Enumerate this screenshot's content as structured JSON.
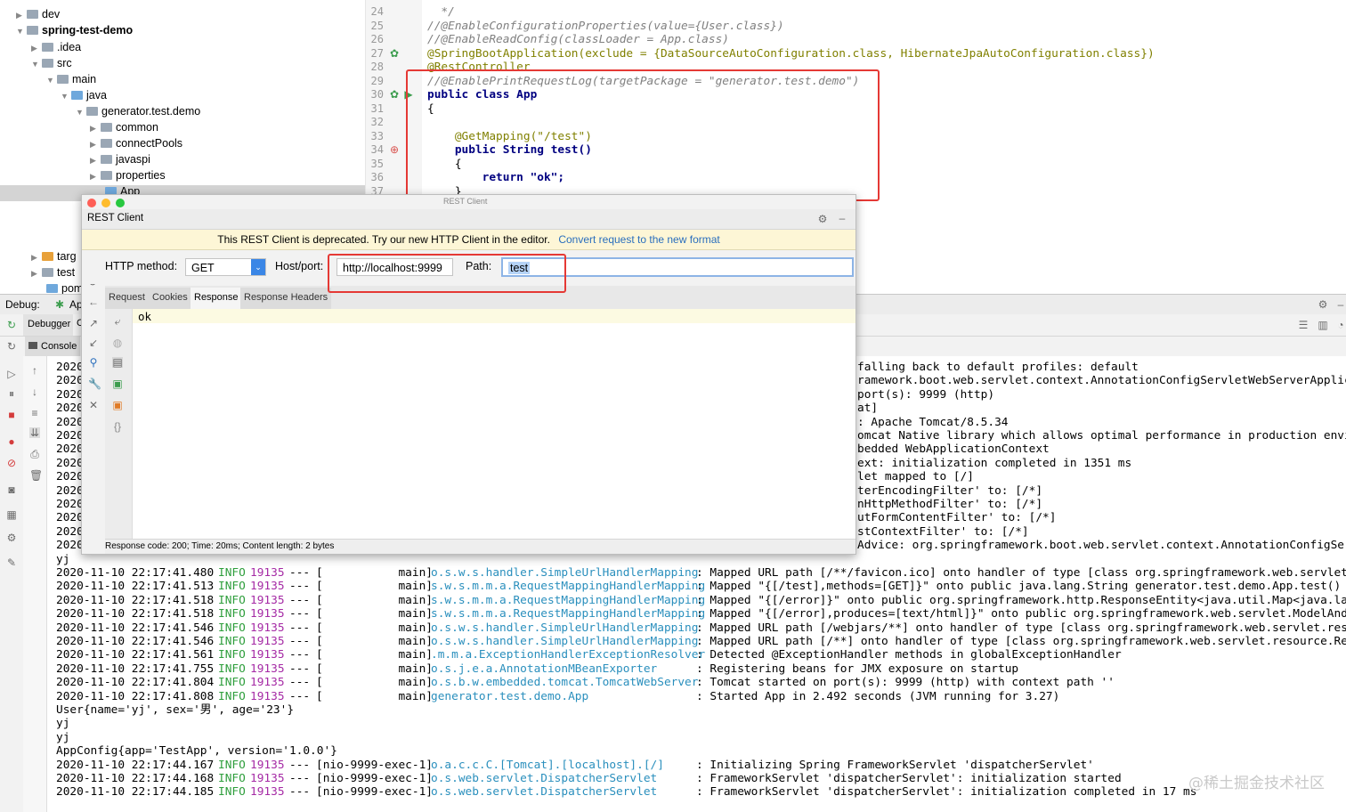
{
  "project_tree": {
    "items": [
      {
        "label": "dev"
      },
      {
        "label": "spring-test-demo"
      },
      {
        "label": ".idea"
      },
      {
        "label": "src"
      },
      {
        "label": "main"
      },
      {
        "label": "java"
      },
      {
        "label": "generator.test.demo"
      },
      {
        "label": "common"
      },
      {
        "label": "connectPools"
      },
      {
        "label": "javaspi"
      },
      {
        "label": "properties"
      },
      {
        "label": "App"
      },
      {
        "label": "targ"
      },
      {
        "label": "test"
      },
      {
        "label": "pom"
      }
    ]
  },
  "editor": {
    "line_numbers": [
      "24",
      "25",
      "26",
      "27",
      "28",
      "29",
      "30",
      "31",
      "32",
      "33",
      "34",
      "35",
      "36",
      "37"
    ],
    "lines": [
      {
        "text": "*/",
        "style": "cmt",
        "indent": "  "
      },
      {
        "text": "//@EnableConfigurationProperties(value={User.class})",
        "style": "cmt",
        "indent": ""
      },
      {
        "text": "//@EnableReadConfig(classLoader = App.class)",
        "style": "cmt",
        "indent": ""
      },
      {
        "text": "@SpringBootApplication(exclude = {DataSourceAutoConfiguration.class, HibernateJpaAutoConfiguration.class})",
        "style": "ann",
        "indent": ""
      },
      {
        "text": "@RestController",
        "style": "ann",
        "indent": ""
      },
      {
        "text": "//@EnablePrintRequestLog(targetPackage = \"generator.test.demo\")",
        "style": "cmt",
        "indent": ""
      },
      {
        "text": "public class App",
        "style": "kw",
        "indent": ""
      },
      {
        "text": "{",
        "style": "plain",
        "indent": ""
      },
      {
        "text": "",
        "style": "plain",
        "indent": ""
      },
      {
        "text": "@GetMapping(\"/test\")",
        "style": "ann",
        "indent": "    "
      },
      {
        "text": "public String test()",
        "style": "kw",
        "indent": "    "
      },
      {
        "text": "{",
        "style": "plain",
        "indent": "    "
      },
      {
        "text": "return \"ok\";",
        "style": "kw",
        "indent": "        "
      },
      {
        "text": "}",
        "style": "plain",
        "indent": "    "
      }
    ]
  },
  "rest_client": {
    "title": "REST Client",
    "overlay_label": "REST Client",
    "banner_text": "This REST Client is deprecated. Try our new HTTP Client in the editor.",
    "banner_link": "Convert request to the new format",
    "http_method_label": "HTTP method:",
    "http_method_value": "GET",
    "host_label": "Host/port:",
    "host_value": "http://localhost:9999",
    "path_label": "Path:",
    "path_value": "test",
    "tabs": [
      "Request",
      "Cookies",
      "Response",
      "Response Headers"
    ],
    "active_tab": "Response",
    "response_body": "ok",
    "status_line": "Response code: 200; Time: 20ms; Content length: 2 bytes"
  },
  "debug": {
    "label": "Debug:",
    "run_tab": "Ap",
    "tabs": [
      "Debugger",
      "C"
    ],
    "console_tab": "Console"
  },
  "console": {
    "partial_lines": [
      "2020",
      "2020",
      "2020",
      "2020",
      "2020",
      "2020",
      "2020",
      "2020",
      "2020",
      "2020",
      "2020",
      "2020",
      "2020",
      "2020"
    ],
    "right_fragments": [
      "falling back to default profiles: default",
      "ramework.boot.web.servlet.context.AnnotationConfigServletWebServerApplicatio",
      "port(s): 9999 (http)",
      "at]",
      ": Apache Tomcat/8.5.34",
      "omcat Native library which allows optimal performance in production environme",
      "bedded WebApplicationContext",
      "ext: initialization completed in 1351 ms",
      "let mapped to [/]",
      "terEncodingFilter' to: [/*]",
      "nHttpMethodFilter' to: [/*]",
      "utFormContentFilter' to: [/*]",
      "stContextFilter' to: [/*]",
      "Advice: org.springframework.boot.web.servlet.context.AnnotationConfigServlet"
    ],
    "lines": [
      {
        "plain": "yj"
      },
      {
        "ts": "2020-11-10 22:17:41.480",
        "level": "INFO",
        "pid": "19135",
        "sep": "---",
        "thread": "[           main]",
        "logger": "o.s.w.s.handler.SimpleUrlHandlerMapping",
        "msg": ": Mapped URL path [/**/favicon.ico] onto handler of type [class org.springframework.web.servlet.resou"
      },
      {
        "ts": "2020-11-10 22:17:41.513",
        "level": "INFO",
        "pid": "19135",
        "sep": "---",
        "thread": "[           main]",
        "logger": "s.w.s.m.m.a.RequestMappingHandlerMapping",
        "msg": ": Mapped \"{[/test],methods=[GET]}\" onto public java.lang.String generator.test.demo.App.test()"
      },
      {
        "ts": "2020-11-10 22:17:41.518",
        "level": "INFO",
        "pid": "19135",
        "sep": "---",
        "thread": "[           main]",
        "logger": "s.w.s.m.m.a.RequestMappingHandlerMapping",
        "msg": ": Mapped \"{[/error]}\" onto public org.springframework.http.ResponseEntity<java.util.Map<java.lang.Str"
      },
      {
        "ts": "2020-11-10 22:17:41.518",
        "level": "INFO",
        "pid": "19135",
        "sep": "---",
        "thread": "[           main]",
        "logger": "s.w.s.m.m.a.RequestMappingHandlerMapping",
        "msg": ": Mapped \"{[/error],produces=[text/html]}\" onto public org.springframework.web.servlet.ModelAndView"
      },
      {
        "ts": "2020-11-10 22:17:41.546",
        "level": "INFO",
        "pid": "19135",
        "sep": "---",
        "thread": "[           main]",
        "logger": "o.s.w.s.handler.SimpleUrlHandlerMapping",
        "msg": ": Mapped URL path [/webjars/**] onto handler of type [class org.springframework.web.servlet.resource."
      },
      {
        "ts": "2020-11-10 22:17:41.546",
        "level": "INFO",
        "pid": "19135",
        "sep": "---",
        "thread": "[           main]",
        "logger": "o.s.w.s.handler.SimpleUrlHandlerMapping",
        "msg": ": Mapped URL path [/**] onto handler of type [class org.springframework.web.servlet.resource.Resource"
      },
      {
        "ts": "2020-11-10 22:17:41.561",
        "level": "INFO",
        "pid": "19135",
        "sep": "---",
        "thread": "[           main]",
        "logger": ".m.m.a.ExceptionHandlerExceptionResolver",
        "msg": ": Detected @ExceptionHandler methods in globalExceptionHandler"
      },
      {
        "ts": "2020-11-10 22:17:41.755",
        "level": "INFO",
        "pid": "19135",
        "sep": "---",
        "thread": "[           main]",
        "logger": "o.s.j.e.a.AnnotationMBeanExporter",
        "msg": ": Registering beans for JMX exposure on startup"
      },
      {
        "ts": "2020-11-10 22:17:41.804",
        "level": "INFO",
        "pid": "19135",
        "sep": "---",
        "thread": "[           main]",
        "logger": "o.s.b.w.embedded.tomcat.TomcatWebServer",
        "msg": ": Tomcat started on port(s): 9999 (http) with context path ''"
      },
      {
        "ts": "2020-11-10 22:17:41.808",
        "level": "INFO",
        "pid": "19135",
        "sep": "---",
        "thread": "[           main]",
        "logger": "generator.test.demo.App",
        "msg": ": Started App in 2.492 seconds (JVM running for 3.27)"
      },
      {
        "plain": "User{name='yj', sex='男', age='23'}"
      },
      {
        "plain": "yj"
      },
      {
        "plain": "yj"
      },
      {
        "plain": "AppConfig{app='TestApp', version='1.0.0'}"
      },
      {
        "ts": "2020-11-10 22:17:44.167",
        "level": "INFO",
        "pid": "19135",
        "sep": "---",
        "thread": "[nio-9999-exec-1]",
        "logger": "o.a.c.c.C.[Tomcat].[localhost].[/]",
        "msg": ": Initializing Spring FrameworkServlet 'dispatcherServlet'"
      },
      {
        "ts": "2020-11-10 22:17:44.168",
        "level": "INFO",
        "pid": "19135",
        "sep": "---",
        "thread": "[nio-9999-exec-1]",
        "logger": "o.s.web.servlet.DispatcherServlet",
        "msg": ": FrameworkServlet 'dispatcherServlet': initialization started"
      },
      {
        "ts": "2020-11-10 22:17:44.185",
        "level": "INFO",
        "pid": "19135",
        "sep": "---",
        "thread": "[nio-9999-exec-1]",
        "logger": "o.s.web.servlet.DispatcherServlet",
        "msg": ": FrameworkServlet 'dispatcherServlet': initialization completed in 17 ms"
      }
    ]
  },
  "watermark": "@稀土掘金技术社区",
  "colors": {
    "annotation_box": "#e53935",
    "info": "#2e9e3c",
    "logger": "#2a8fbd",
    "pid": "#a52aa5",
    "banner_bg": "#fdf6d6",
    "link": "#2a6ebd"
  }
}
